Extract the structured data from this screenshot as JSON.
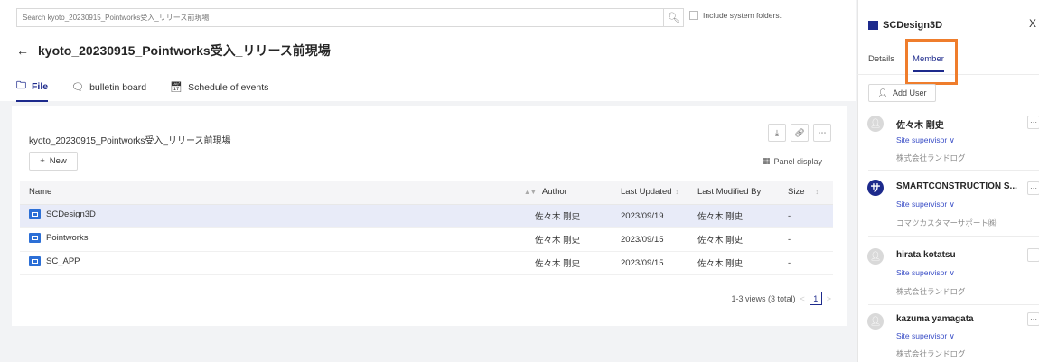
{
  "search": {
    "placeholder": "Search kyoto_20230915_Pointworks受入_リリース前現場",
    "include_system": "Include system folders."
  },
  "page": {
    "title": "kyoto_20230915_Pointworks受入_リリース前現場"
  },
  "tabs": [
    {
      "label": "File",
      "icon": "folder-icon"
    },
    {
      "label": "bulletin board",
      "icon": "chat-icon"
    },
    {
      "label": "Schedule of events",
      "icon": "calendar-icon"
    }
  ],
  "card": {
    "title": "kyoto_20230915_Pointworks受入_リリース前現場",
    "new_label": "New",
    "panel_display": "Panel display",
    "columns": {
      "name": "Name",
      "author": "Author",
      "last_updated": "Last Updated",
      "last_modified_by": "Last Modified By",
      "size": "Size"
    },
    "rows": [
      {
        "name": "SCDesign3D",
        "author": "佐々木 剛史",
        "updated": "2023/09/19",
        "modified_by": "佐々木 剛史",
        "size": "-"
      },
      {
        "name": "Pointworks",
        "author": "佐々木 剛史",
        "updated": "2023/09/15",
        "modified_by": "佐々木 剛史",
        "size": "-"
      },
      {
        "name": "SC_APP",
        "author": "佐々木 剛史",
        "updated": "2023/09/15",
        "modified_by": "佐々木 剛史",
        "size": "-"
      }
    ],
    "pager": {
      "summary": "1-3 views (3 total)",
      "page": "1"
    }
  },
  "panel": {
    "title": "SCDesign3D",
    "close": "X",
    "tabs": {
      "details": "Details",
      "member": "Member"
    },
    "add_user": "Add User",
    "members": [
      {
        "name": "佐々木 剛史",
        "role": "Site supervisor",
        "org": "株式会社ランドログ",
        "avatar": "person"
      },
      {
        "name": "SMARTCONSTRUCTION S...",
        "role": "Site supervisor",
        "org": "コマツカスタマーサポート㈱",
        "avatar": "brand",
        "avatar_text": "サ"
      },
      {
        "name": "hirata kotatsu",
        "role": "Site supervisor",
        "org": "株式会社ランドログ",
        "avatar": "person"
      },
      {
        "name": "kazuma yamagata",
        "role": "Site supervisor",
        "org": "株式会社ランドログ",
        "avatar": "person"
      }
    ]
  },
  "colors": {
    "accent": "#1d2a8c",
    "highlight": "#ef7d2c",
    "folder": "#2c6fd6"
  }
}
